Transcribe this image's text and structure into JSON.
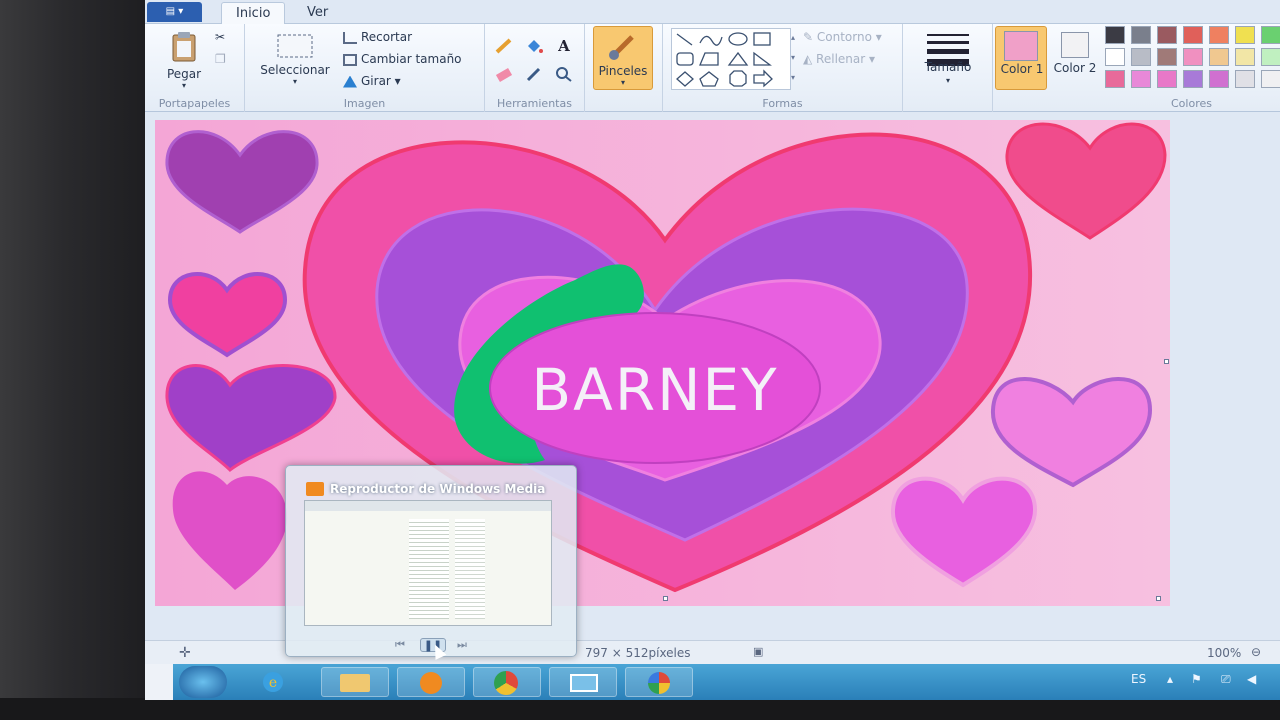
{
  "ribbon": {
    "tabs": [
      "Inicio",
      "Ver"
    ],
    "groups": {
      "portapapeles": {
        "label": "Portapapeles",
        "paste": "Pegar"
      },
      "imagen": {
        "label": "Imagen",
        "select": "Seleccionar",
        "crop": "Recortar",
        "resize": "Cambiar tamaño",
        "rotate": "Girar"
      },
      "herramientas": {
        "label": "Herramientas"
      },
      "pinceles": {
        "label": "Pinceles"
      },
      "formas": {
        "label": "Formas",
        "outline": "Contorno",
        "fill": "Rellenar"
      },
      "tamano": {
        "label": "Tamaño"
      },
      "color1": {
        "label": "Color 1"
      },
      "color2": {
        "label": "Color 2"
      },
      "colores": {
        "label": "Colores"
      }
    },
    "palette": [
      "#3b3b44",
      "#7a7f8c",
      "#9a5a60",
      "#e0605a",
      "#ef8060",
      "#f0e050",
      "#6ad070",
      "#ffffff",
      "#b8bcc6",
      "#a07a78",
      "#f090c0",
      "#f0c890",
      "#f2e6a6",
      "#c0f0c0",
      "#e86a9a",
      "#e888d8",
      "#e878c8",
      "#a87ad8",
      "#d070d0",
      "#e0e0e6",
      "#f0f0f2"
    ],
    "color1": "#f0a0c8",
    "color2": "#f2f2f4"
  },
  "canvas": {
    "text": "BARNEY",
    "size": "797 × 512píxeles"
  },
  "thumbnail": {
    "title": "Reproductor de Windows Media"
  },
  "status": {
    "zoom": "100%",
    "lang": "ES"
  }
}
